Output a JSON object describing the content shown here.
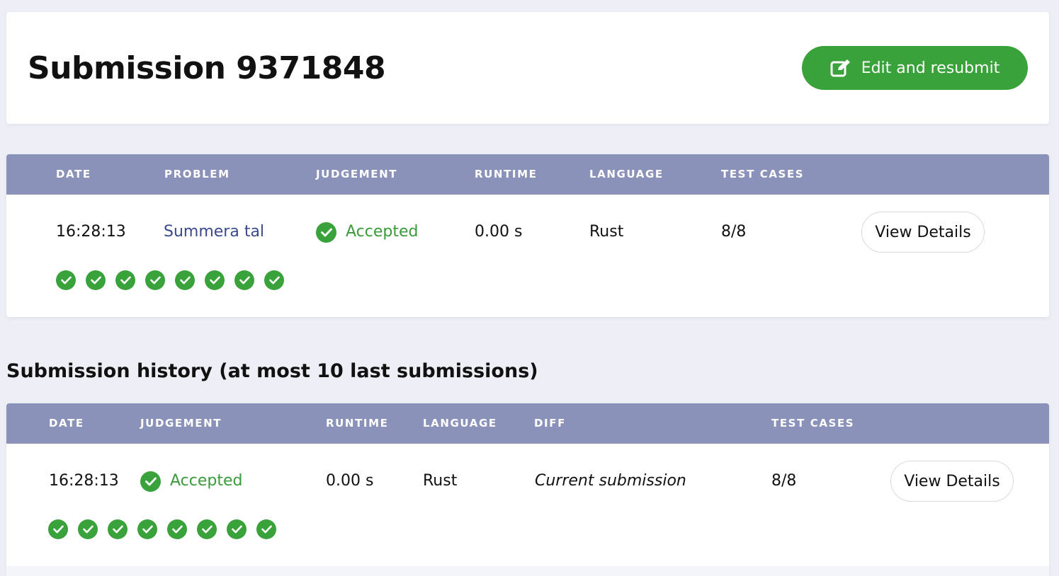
{
  "header": {
    "title": "Submission 9371848",
    "resubmit_label": "Edit and resubmit"
  },
  "submission": {
    "columns": [
      "DATE",
      "PROBLEM",
      "JUDGEMENT",
      "RUNTIME",
      "LANGUAGE",
      "TEST CASES"
    ],
    "row": {
      "date": "16:28:13",
      "problem": "Summera tal",
      "judgement": "Accepted",
      "runtime": "0.00 s",
      "language": "Rust",
      "test_cases": "8/8",
      "details_label": "View Details"
    },
    "test_results": [
      "accepted",
      "accepted",
      "accepted",
      "accepted",
      "accepted",
      "accepted",
      "accepted",
      "accepted"
    ]
  },
  "history": {
    "heading": "Submission history (at most 10 last submissions)",
    "columns": [
      "DATE",
      "JUDGEMENT",
      "RUNTIME",
      "LANGUAGE",
      "DIFF",
      "TEST CASES"
    ],
    "rows": [
      {
        "date": "16:28:13",
        "judgement": "Accepted",
        "runtime": "0.00 s",
        "language": "Rust",
        "diff": "Current submission",
        "test_cases": "8/8",
        "details_label": "View Details",
        "test_results": [
          "accepted",
          "accepted",
          "accepted",
          "accepted",
          "accepted",
          "accepted",
          "accepted",
          "accepted"
        ]
      }
    ]
  },
  "colors": {
    "accent_green": "#3aa23a",
    "accepted_text": "#3a9b3a",
    "table_header": "#8b92b9",
    "problem_link": "#3b4a8c",
    "page_bg": "#eeeff6"
  },
  "icons": {
    "resubmit": "edit-icon",
    "verdict": "check-circle-icon",
    "test_case": "check-circle-icon"
  }
}
